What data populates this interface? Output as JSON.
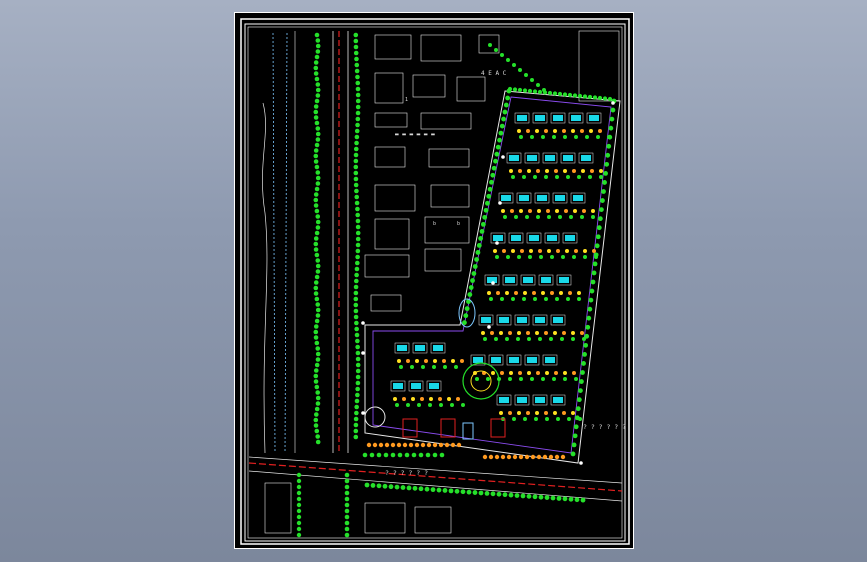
{
  "app": {
    "title": ""
  },
  "drawing": {
    "background": "#000000",
    "frame_color": "#ffffff",
    "labels": {
      "title_bar": "▬ ▬ ▬ ▬ ▬ ▬",
      "road_label_upper": "4 E A C",
      "question_east": "? ? ? ? ? ?",
      "question_south": "? ? ? ? ? ?",
      "block_small_a": "1",
      "block_small_b": "b",
      "block_small_c": "b"
    },
    "colors": {
      "tree_green": "#25e02a",
      "road_red": "#e02020",
      "building_cyan": "#19d8e8",
      "boundary_purple": "#8b4cf0",
      "flower_orange": "#ff9a20",
      "flower_yellow": "#ffe020",
      "water_blue": "#7ec8ff",
      "line_white": "#e8e8e8"
    }
  }
}
